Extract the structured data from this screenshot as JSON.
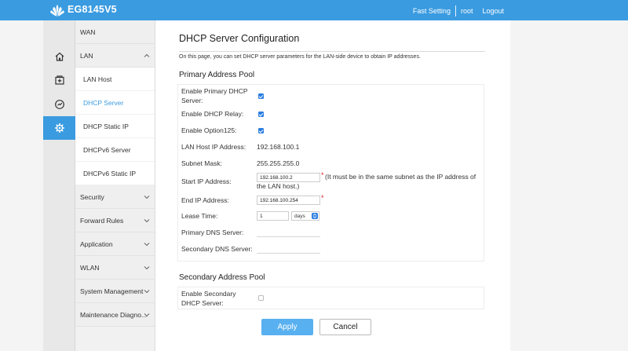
{
  "header": {
    "brand": "EG8145V5",
    "fast_setting": "Fast Setting",
    "user": "root",
    "logout": "Logout"
  },
  "rail": {
    "icons": [
      "home-icon",
      "add-box-icon",
      "gauge-icon",
      "gear-icon"
    ],
    "active": "gear-icon"
  },
  "sidebar": {
    "items": [
      {
        "label": "WAN",
        "type": "top"
      },
      {
        "label": "LAN",
        "type": "top-open"
      },
      {
        "label": "LAN Host",
        "type": "sub"
      },
      {
        "label": "DHCP Server",
        "type": "sub-selected"
      },
      {
        "label": "DHCP Static IP",
        "type": "sub"
      },
      {
        "label": "DHCPv6 Server",
        "type": "sub"
      },
      {
        "label": "DHCPv6 Static IP",
        "type": "sub"
      },
      {
        "label": "Security",
        "type": "top"
      },
      {
        "label": "Forward Rules",
        "type": "top"
      },
      {
        "label": "Application",
        "type": "top"
      },
      {
        "label": "WLAN",
        "type": "top"
      },
      {
        "label": "System Management",
        "type": "top"
      },
      {
        "label": "Maintenance Diagno...",
        "type": "top"
      }
    ]
  },
  "main": {
    "title": "DHCP Server Configuration",
    "description": "On this page, you can set DHCP server parameters for the LAN-side device to obtain IP addresses.",
    "primary": {
      "title": "Primary Address Pool",
      "enable_primary_label_1": "Enable Primary DHCP",
      "enable_primary_label_2": "Server:",
      "enable_primary_checked": true,
      "enable_relay_label": "Enable DHCP Relay:",
      "enable_relay_checked": true,
      "enable_option125_label": "Enable Option125:",
      "enable_option125_checked": true,
      "lan_host_ip_label": "LAN Host IP Address:",
      "lan_host_ip_value": "192.168.100.1",
      "subnet_mask_label": "Subnet Mask:",
      "subnet_mask_value": "255.255.255.0",
      "start_ip_label": "Start IP Address:",
      "start_ip_value": "192.168.100.2",
      "start_ip_hint_1": "(It must be in the same subnet as the IP address of",
      "start_ip_hint_2": "the LAN host.)",
      "end_ip_label": "End IP Address:",
      "end_ip_value": "192.168.100.254",
      "lease_time_label": "Lease Time:",
      "lease_time_value": "1",
      "lease_unit": "days",
      "primary_dns_label": "Primary DNS Server:",
      "primary_dns_value": "",
      "secondary_dns_label": "Secondary DNS Server:",
      "secondary_dns_value": "",
      "required_mark": "*"
    },
    "secondary": {
      "title": "Secondary Address Pool",
      "enable_secondary_label_1": "Enable Secondary",
      "enable_secondary_label_2": "DHCP Server:",
      "enable_secondary_checked": false
    },
    "apply_label": "Apply",
    "cancel_label": "Cancel"
  },
  "colors": {
    "brand_blue": "#3a9be0",
    "checkbox_blue": "#2a7de1",
    "apply_blue": "#59b0f0",
    "required_red": "#e02020"
  }
}
